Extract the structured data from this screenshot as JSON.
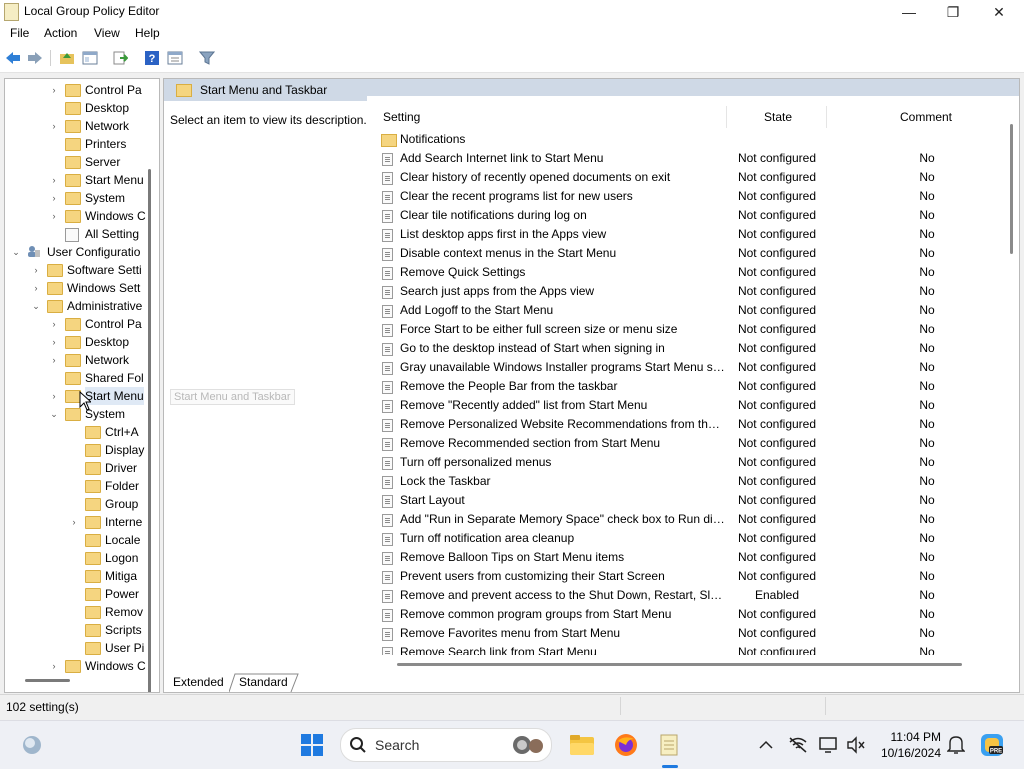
{
  "window": {
    "title": "Local Group Policy Editor",
    "minimize_glyph": "—",
    "maximize_glyph": "❐",
    "close_glyph": "✕"
  },
  "menubar": [
    "File",
    "Action",
    "View",
    "Help"
  ],
  "toolbar": {
    "icons": [
      "back-icon",
      "forward-icon",
      "up-folder-icon",
      "show-hide-tree-icon",
      "export-list-icon",
      "help-icon",
      "properties-icon",
      "filter-icon"
    ]
  },
  "tree": {
    "items": [
      {
        "label": "Control Pa",
        "indent": 3,
        "arrow": "›",
        "type": "folder"
      },
      {
        "label": "Desktop",
        "indent": 3,
        "arrow": "",
        "type": "folder"
      },
      {
        "label": "Network",
        "indent": 3,
        "arrow": "›",
        "type": "folder"
      },
      {
        "label": "Printers",
        "indent": 3,
        "arrow": "",
        "type": "folder"
      },
      {
        "label": "Server",
        "indent": 3,
        "arrow": "",
        "type": "folder"
      },
      {
        "label": "Start Menu",
        "indent": 3,
        "arrow": "›",
        "type": "folder"
      },
      {
        "label": "System",
        "indent": 3,
        "arrow": "›",
        "type": "folder"
      },
      {
        "label": "Windows C",
        "indent": 3,
        "arrow": "›",
        "type": "folder"
      },
      {
        "label": "All Setting",
        "indent": 3,
        "arrow": "",
        "type": "settings"
      },
      {
        "label": "User Configuratio",
        "indent": 1,
        "arrow": "⌄",
        "type": "user"
      },
      {
        "label": "Software Setti",
        "indent": 2,
        "arrow": "›",
        "type": "folder"
      },
      {
        "label": "Windows Sett",
        "indent": 2,
        "arrow": "›",
        "type": "folder"
      },
      {
        "label": "Administrative",
        "indent": 2,
        "arrow": "⌄",
        "type": "folder"
      },
      {
        "label": "Control Pa",
        "indent": 3,
        "arrow": "›",
        "type": "folder"
      },
      {
        "label": "Desktop",
        "indent": 3,
        "arrow": "›",
        "type": "folder"
      },
      {
        "label": "Network",
        "indent": 3,
        "arrow": "›",
        "type": "folder"
      },
      {
        "label": "Shared Fol",
        "indent": 3,
        "arrow": "",
        "type": "folder"
      },
      {
        "label": "Start Menu",
        "indent": 3,
        "arrow": "›",
        "type": "folder",
        "selected": true
      },
      {
        "label": "System",
        "indent": 3,
        "arrow": "⌄",
        "type": "folder"
      },
      {
        "label": "Ctrl+A",
        "indent": 4,
        "arrow": "",
        "type": "folder"
      },
      {
        "label": "Display",
        "indent": 4,
        "arrow": "",
        "type": "folder"
      },
      {
        "label": "Driver",
        "indent": 4,
        "arrow": "",
        "type": "folder"
      },
      {
        "label": "Folder",
        "indent": 4,
        "arrow": "",
        "type": "folder"
      },
      {
        "label": "Group",
        "indent": 4,
        "arrow": "",
        "type": "folder"
      },
      {
        "label": "Interne",
        "indent": 4,
        "arrow": "›",
        "type": "folder"
      },
      {
        "label": "Locale",
        "indent": 4,
        "arrow": "",
        "type": "folder"
      },
      {
        "label": "Logon",
        "indent": 4,
        "arrow": "",
        "type": "folder"
      },
      {
        "label": "Mitiga",
        "indent": 4,
        "arrow": "",
        "type": "folder"
      },
      {
        "label": "Power",
        "indent": 4,
        "arrow": "",
        "type": "folder"
      },
      {
        "label": "Remov",
        "indent": 4,
        "arrow": "",
        "type": "folder"
      },
      {
        "label": "Scripts",
        "indent": 4,
        "arrow": "",
        "type": "folder"
      },
      {
        "label": "User Pi",
        "indent": 4,
        "arrow": "",
        "type": "folder"
      },
      {
        "label": "Windows C",
        "indent": 3,
        "arrow": "›",
        "type": "folder"
      }
    ],
    "tooltip": "Start Menu and Taskbar"
  },
  "right_pane": {
    "header": "Start Menu and Taskbar",
    "description": "Select an item to view its description.",
    "columns": {
      "setting": "Setting",
      "state": "State",
      "comment": "Comment"
    },
    "rows": [
      {
        "name": "Notifications",
        "state": "",
        "comment": "",
        "type": "folder"
      },
      {
        "name": "Add Search Internet link to Start Menu",
        "state": "Not configured",
        "comment": "No",
        "type": "setting"
      },
      {
        "name": "Clear history of recently opened documents on exit",
        "state": "Not configured",
        "comment": "No",
        "type": "setting"
      },
      {
        "name": "Clear the recent programs list for new users",
        "state": "Not configured",
        "comment": "No",
        "type": "setting"
      },
      {
        "name": "Clear tile notifications during log on",
        "state": "Not configured",
        "comment": "No",
        "type": "setting"
      },
      {
        "name": "List desktop apps first in the Apps view",
        "state": "Not configured",
        "comment": "No",
        "type": "setting"
      },
      {
        "name": "Disable context menus in the Start Menu",
        "state": "Not configured",
        "comment": "No",
        "type": "setting"
      },
      {
        "name": "Remove Quick Settings",
        "state": "Not configured",
        "comment": "No",
        "type": "setting"
      },
      {
        "name": "Search just apps from the Apps view",
        "state": "Not configured",
        "comment": "No",
        "type": "setting"
      },
      {
        "name": "Add Logoff to the Start Menu",
        "state": "Not configured",
        "comment": "No",
        "type": "setting"
      },
      {
        "name": "Force Start to be either full screen size or menu size",
        "state": "Not configured",
        "comment": "No",
        "type": "setting"
      },
      {
        "name": "Go to the desktop instead of Start when signing in",
        "state": "Not configured",
        "comment": "No",
        "type": "setting"
      },
      {
        "name": "Gray unavailable Windows Installer programs Start Menu sh...",
        "state": "Not configured",
        "comment": "No",
        "type": "setting"
      },
      {
        "name": "Remove the People Bar from the taskbar",
        "state": "Not configured",
        "comment": "No",
        "type": "setting"
      },
      {
        "name": "Remove \"Recently added\" list from Start Menu",
        "state": "Not configured",
        "comment": "No",
        "type": "setting"
      },
      {
        "name": "Remove Personalized Website Recommendations from the ...",
        "state": "Not configured",
        "comment": "No",
        "type": "setting"
      },
      {
        "name": "Remove Recommended section from Start Menu",
        "state": "Not configured",
        "comment": "No",
        "type": "setting"
      },
      {
        "name": "Turn off personalized menus",
        "state": "Not configured",
        "comment": "No",
        "type": "setting"
      },
      {
        "name": "Lock the Taskbar",
        "state": "Not configured",
        "comment": "No",
        "type": "setting"
      },
      {
        "name": "Start Layout",
        "state": "Not configured",
        "comment": "No",
        "type": "setting"
      },
      {
        "name": "Add \"Run in Separate Memory Space\" check box to Run dial...",
        "state": "Not configured",
        "comment": "No",
        "type": "setting"
      },
      {
        "name": "Turn off notification area cleanup",
        "state": "Not configured",
        "comment": "No",
        "type": "setting"
      },
      {
        "name": "Remove Balloon Tips on Start Menu items",
        "state": "Not configured",
        "comment": "No",
        "type": "setting"
      },
      {
        "name": "Prevent users from customizing their Start Screen",
        "state": "Not configured",
        "comment": "No",
        "type": "setting"
      },
      {
        "name": "Remove and prevent access to the Shut Down, Restart, Sleep...",
        "state": "Enabled",
        "comment": "No",
        "type": "setting"
      },
      {
        "name": "Remove common program groups from Start Menu",
        "state": "Not configured",
        "comment": "No",
        "type": "setting"
      },
      {
        "name": "Remove Favorites menu from Start Menu",
        "state": "Not configured",
        "comment": "No",
        "type": "setting"
      },
      {
        "name": "Remove Search link from Start Menu",
        "state": "Not configured",
        "comment": "No",
        "type": "setting"
      }
    ]
  },
  "tabs": [
    "Extended",
    "Standard"
  ],
  "statusbar": {
    "text": "102 setting(s)"
  },
  "taskbar": {
    "search_placeholder": "Search",
    "time": "11:04 PM",
    "date": "10/16/2024",
    "icons": [
      "widgets-icon",
      "start-icon",
      "search-icon",
      "file-explorer-icon",
      "firefox-icon",
      "notepad-icon",
      "chevron-up-icon",
      "network-icon",
      "display-icon",
      "sound-off-icon",
      "notification-bell-icon",
      "copilot-icon"
    ]
  }
}
